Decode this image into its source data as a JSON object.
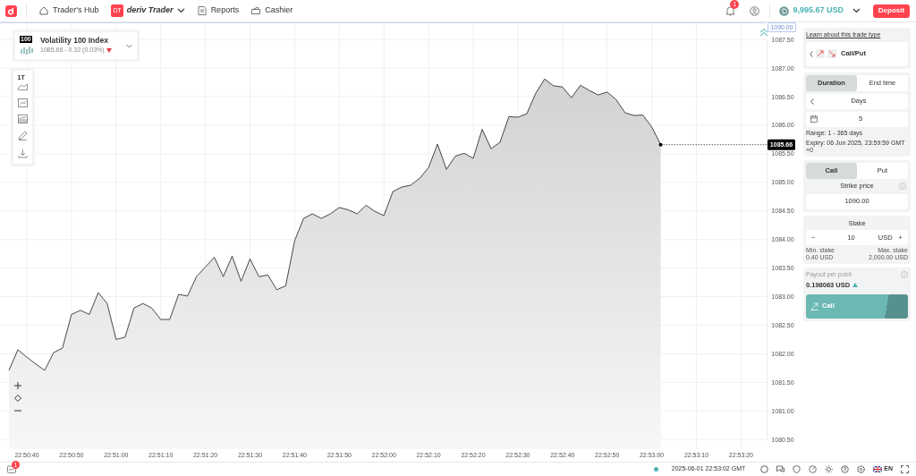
{
  "header": {
    "hub": "Trader's Hub",
    "app_badge": "DT",
    "app_name": "deriv Trader",
    "nav": [
      "Reports",
      "Cashier"
    ],
    "notification_count": "1",
    "balance": "9,995.67 USD",
    "deposit": "Deposit"
  },
  "symbol": {
    "badge": "100",
    "name": "Volatility 100 Index",
    "quote": "1085.66 - 0.32 (0.03%)",
    "rising": false
  },
  "chart": {
    "interval": "1T",
    "barrier_label": "1090.00",
    "price_label": "1085.66",
    "chart_data": {
      "type": "area",
      "categories": [
        null,
        null,
        "22:50:40",
        null,
        null,
        null,
        null,
        "22:50:50",
        null,
        null,
        null,
        null,
        "22:51:00",
        null,
        null,
        null,
        null,
        "22:51:10",
        null,
        null,
        null,
        null,
        "22:51:20",
        null,
        null,
        null,
        null,
        "22:51:30",
        null,
        null,
        null,
        null,
        "22:51:40",
        null,
        null,
        null,
        null,
        "22:51:50",
        null,
        null,
        null,
        null,
        "22:52:00",
        null,
        null,
        null,
        null,
        "22:52:10",
        null,
        null,
        null,
        null,
        "22:52:20",
        null,
        null,
        null,
        null,
        "22:52:30",
        null,
        null,
        null,
        null,
        "22:52:40",
        null,
        null,
        null,
        null,
        "22:52:50",
        null,
        null,
        null,
        null,
        "22:53:00",
        null,
        null,
        null,
        null,
        "22:53:10",
        null,
        null,
        null,
        null,
        "22:53:20"
      ],
      "series": [
        {
          "color": "#333333",
          "values": [
            1081.71,
            1082.07,
            1081.94,
            1081.82,
            1081.71,
            1082.02,
            1082.1,
            1082.69,
            1082.76,
            1082.69,
            1083.07,
            1082.88,
            1082.25,
            1082.29,
            1082.8,
            1082.88,
            1082.8,
            1082.6,
            1082.6,
            1083.04,
            1083.01,
            1083.35,
            1083.52,
            1083.69,
            1083.35,
            1083.71,
            1083.27,
            1083.66,
            1083.35,
            1083.38,
            1083.12,
            1083.19,
            1083.98,
            1084.37,
            1084.45,
            1084.37,
            1084.45,
            1084.56,
            1084.52,
            1084.45,
            1084.6,
            1084.49,
            1084.42,
            1084.84,
            1084.92,
            1084.95,
            1085.07,
            1085.26,
            1085.67,
            1085.23,
            1085.46,
            1085.51,
            1085.42,
            1085.93,
            1085.59,
            1085.7,
            1086.15,
            1086.14,
            1086.2,
            1086.56,
            1086.81,
            1086.69,
            1086.67,
            1086.48,
            1086.7,
            1086.61,
            1086.53,
            1086.58,
            1086.45,
            1086.22,
            1086.17,
            1086.18,
            1085.97,
            1085.66,
            null,
            null,
            null,
            null,
            null,
            null,
            null,
            null,
            null
          ]
        }
      ],
      "grid": true,
      "ylim": [
        1080.5,
        1087.5
      ],
      "yticks": [
        {
          "value": 1080.5,
          "label": "1080.50"
        },
        {
          "value": 1081,
          "label": "1081.00"
        },
        {
          "value": 1081.5,
          "label": "1081.50"
        },
        {
          "value": 1082,
          "label": "1082.00"
        },
        {
          "value": 1082.5,
          "label": "1082.50"
        },
        {
          "value": 1083,
          "label": "1083.00"
        },
        {
          "value": 1083.5,
          "label": "1083.50"
        },
        {
          "value": 1084,
          "label": "1084.00"
        },
        {
          "value": 1084.5,
          "label": "1084.50"
        },
        {
          "value": 1085,
          "label": "1085.00"
        },
        {
          "value": 1085.5,
          "label": "1085.50"
        },
        {
          "value": 1086,
          "label": "1086.00"
        },
        {
          "value": 1086.5,
          "label": "1086.50"
        },
        {
          "value": 1087,
          "label": "1087.00"
        },
        {
          "value": 1087.5,
          "label": "1087.50"
        }
      ]
    }
  },
  "trade": {
    "learn_link": "Learn about this trade type",
    "trade_type": "Call/Put",
    "duration_tabs": [
      {
        "label": "Duration",
        "selected": true
      },
      {
        "label": "End time",
        "selected": false
      }
    ],
    "duration_unit": "Days",
    "duration_value": "5",
    "range": "Range: 1 - 365 days",
    "expiry": "Expiry: 06 Jun 2025, 23:59:59 GMT +0",
    "contract_tabs": [
      {
        "label": "Call",
        "selected": true
      },
      {
        "label": "Put",
        "selected": false
      }
    ],
    "strike": {
      "label": "Strike price",
      "value": "1090.00"
    },
    "stake": {
      "label": "Stake",
      "minus": "−",
      "value": "10",
      "currency": "USD",
      "plus": "+",
      "min_label": "Min. stake",
      "min_value": "0.40 USD",
      "max_label": "Max. stake",
      "max_value": "2,000.00 USD"
    },
    "payout": {
      "label": "Payout per point",
      "value": "0.198063 USD",
      "rising": true
    },
    "purchase": "Call"
  },
  "footer": {
    "badge": "1",
    "time": "2025-06-01 22:53:02 GMT",
    "language": "EN"
  }
}
